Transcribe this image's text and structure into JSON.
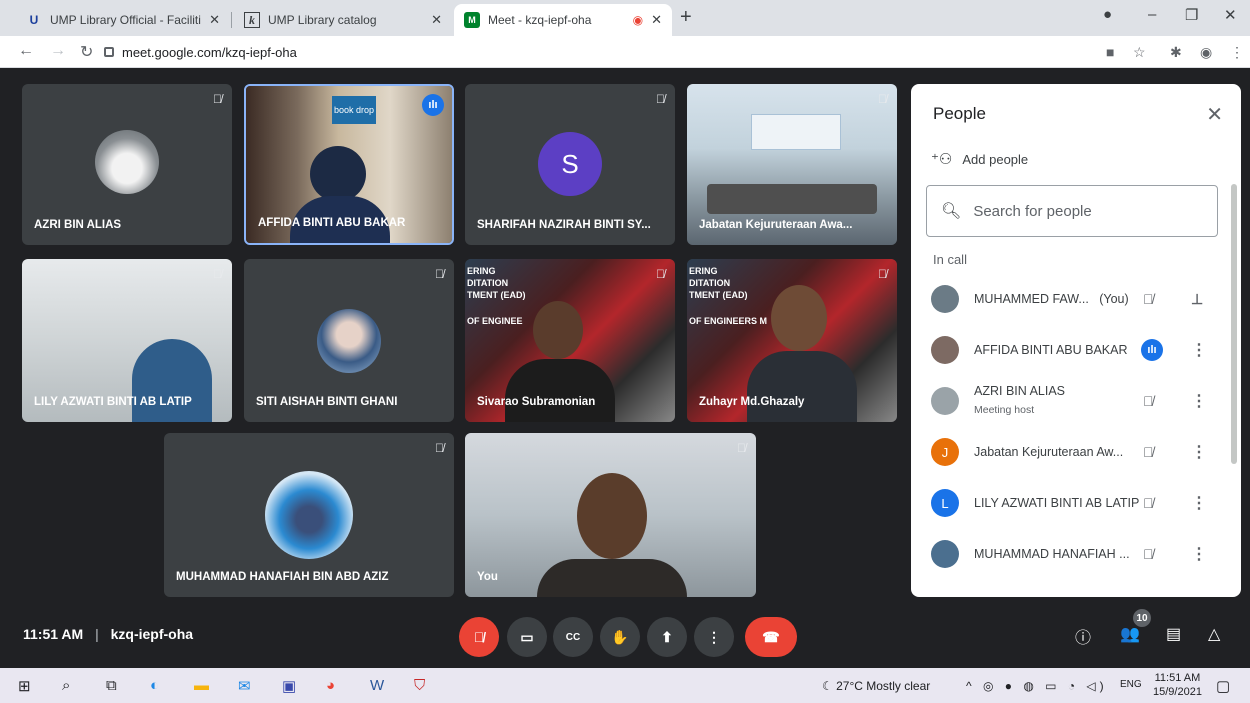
{
  "browser": {
    "tabs": [
      {
        "title": "UMP Library Official - Facilities",
        "favicon": "U"
      },
      {
        "title": "UMP Library catalog",
        "favicon": "k"
      },
      {
        "title": "Meet - kzq-iepf-oha",
        "favicon": "M",
        "recording": true
      }
    ],
    "url": "meet.google.com/kzq-iepf-oha"
  },
  "tiles": [
    {
      "name": "AZRI BIN ALIAS",
      "muted": true
    },
    {
      "name": "AFFIDA BINTI ABU BAKAR",
      "speaking": true,
      "caption": "book drop"
    },
    {
      "name": "SHARIFAH NAZIRAH BINTI SY...",
      "muted": true,
      "letter": "S"
    },
    {
      "name": "Jabatan Kejuruteraan Awa...",
      "muted": true
    },
    {
      "name": "LILY AZWATI BINTI AB LATIP",
      "muted": true
    },
    {
      "name": "SITI AISHAH BINTI GHANI",
      "muted": true
    },
    {
      "name": "Sivarao Subramonian",
      "muted": true,
      "banner": [
        "ERING",
        "DITATION",
        "TMENT (EAD)",
        "OF ENGINEE"
      ]
    },
    {
      "name": "Zuhayr Md.Ghazaly",
      "muted": true,
      "banner": [
        "ERING",
        "DITATION",
        "TMENT (EAD)",
        "OF ENGINEERS M"
      ]
    },
    {
      "name": "MUHAMMAD HANAFIAH BIN ABD AZIZ",
      "muted": true
    },
    {
      "name": "You",
      "muted": true
    }
  ],
  "bottombar": {
    "time": "11:51 AM",
    "separator": "|",
    "meeting_code": "kzq-iepf-oha",
    "participant_count": "10"
  },
  "people_panel": {
    "title": "People",
    "add_people": "Add people",
    "search_placeholder": "Search for people",
    "section": "In call",
    "participants": [
      {
        "name": "MUHAMMED FAW...",
        "tag": "(You)",
        "initial": "",
        "color": "#6b7b86"
      },
      {
        "name": "AFFIDA BINTI ABU BAKAR",
        "initial": "",
        "color": "#7d6a63"
      },
      {
        "name": "AZRI BIN ALIAS",
        "sub": "Meeting host",
        "initial": "",
        "color": "#9aa3a8"
      },
      {
        "name": "Jabatan Kejuruteraan Aw...",
        "initial": "J",
        "color": "#e8710a"
      },
      {
        "name": "LILY AZWATI BINTI AB LATIP",
        "initial": "L",
        "color": "#1a73e8"
      },
      {
        "name": "MUHAMMAD HANAFIAH ...",
        "initial": "",
        "color": "#4b6f8f"
      }
    ]
  },
  "taskbar": {
    "weather": "27°C  Mostly clear",
    "lang": "ENG",
    "clock_time": "11:51 AM",
    "clock_date": "15/9/2021"
  },
  "colors": {
    "meet_bg": "#202124",
    "accent": "#1a73e8",
    "danger": "#ea4335"
  }
}
